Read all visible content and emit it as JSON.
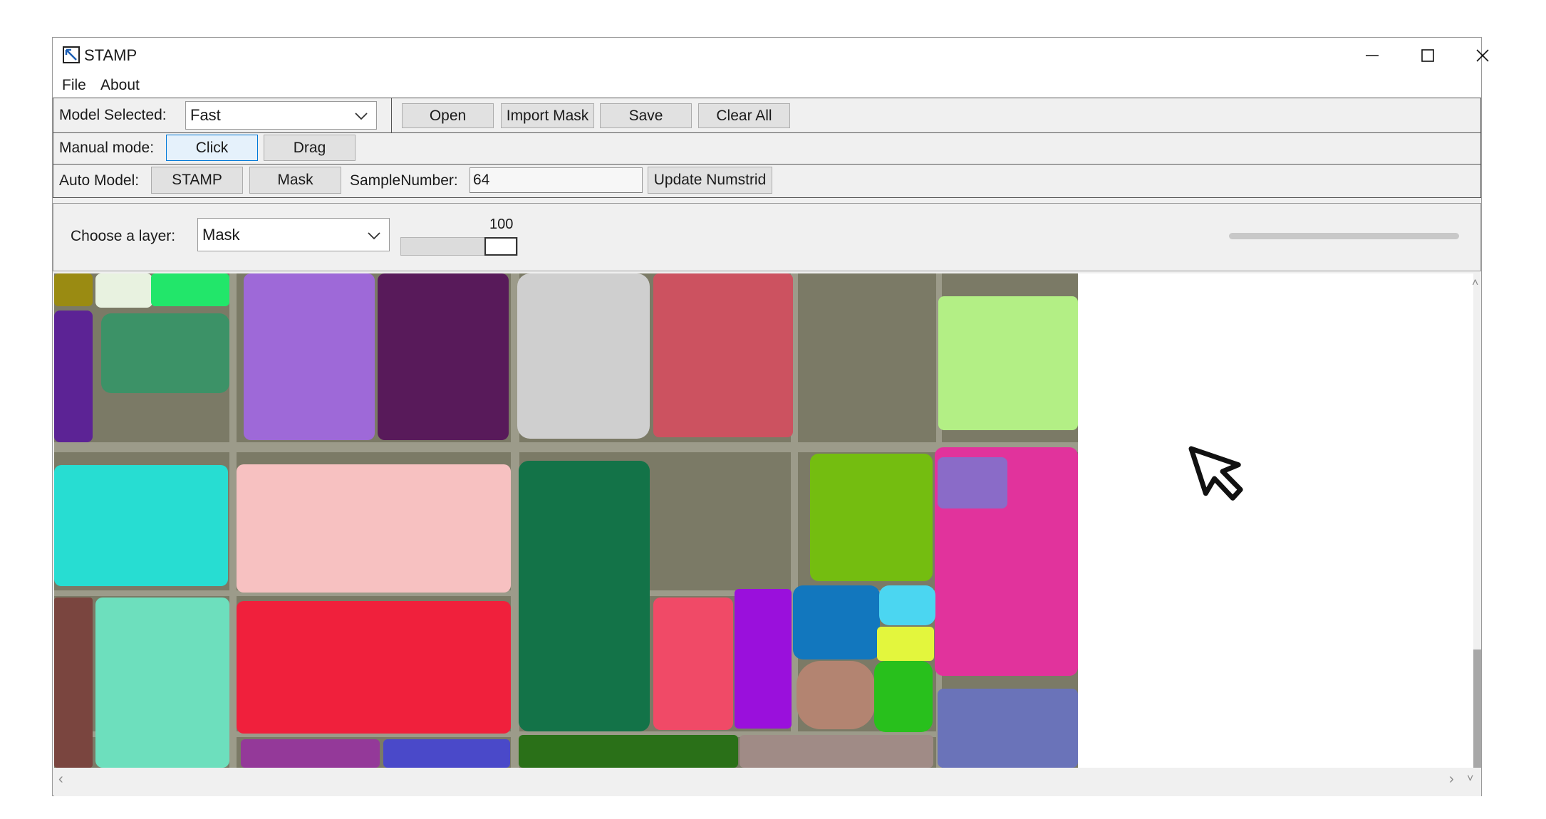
{
  "window": {
    "title": "STAMP",
    "icon": "app-logo-icon"
  },
  "menu": {
    "items": [
      "File",
      "About"
    ]
  },
  "toolbar": {
    "model_label": "Model Selected:",
    "model_value": "Fast",
    "open_label": "Open",
    "import_mask_label": "Import Mask",
    "save_label": "Save",
    "clear_all_label": "Clear All"
  },
  "manual": {
    "label": "Manual mode:",
    "click_label": "Click",
    "drag_label": "Drag",
    "active": "Click"
  },
  "auto": {
    "label": "Auto Model:",
    "stamp_label": "STAMP",
    "mask_label": "Mask",
    "sample_label": "SampleNumber:",
    "sample_value": "64",
    "update_label": "Update Numstrid"
  },
  "layer": {
    "label": "Choose a layer:",
    "value": "Mask",
    "opacity_value": "100",
    "opacity_fraction": 1.0
  },
  "canvas": {
    "background": "#7b7a66",
    "road_color": "#9c9b8a",
    "segment_colors": [
      "#9a8b12",
      "#e8f2e0",
      "#22e66a",
      "#5c2395",
      "#3c9267",
      "#9e69d8",
      "#581a5a",
      "#cfcfcf",
      "#cc5260",
      "#b3ef85",
      "#27ddd2",
      "#f7c1c1",
      "#137348",
      "#74bd10",
      "#e1339c",
      "#8a6bc8",
      "#7a453f",
      "#6ddfbd",
      "#f0203c",
      "#f04a67",
      "#9a10dc",
      "#1277be",
      "#4bd6f1",
      "#e3f63d",
      "#b38471",
      "#28c01c",
      "#6a73b9",
      "#943999",
      "#4a49c9",
      "#2a7018",
      "#a08b86"
    ]
  },
  "scrollbars": {
    "vertical_position": 0.45,
    "vertical_visible_fraction": 0.53
  },
  "cursor": "arrow-cursor-icon"
}
